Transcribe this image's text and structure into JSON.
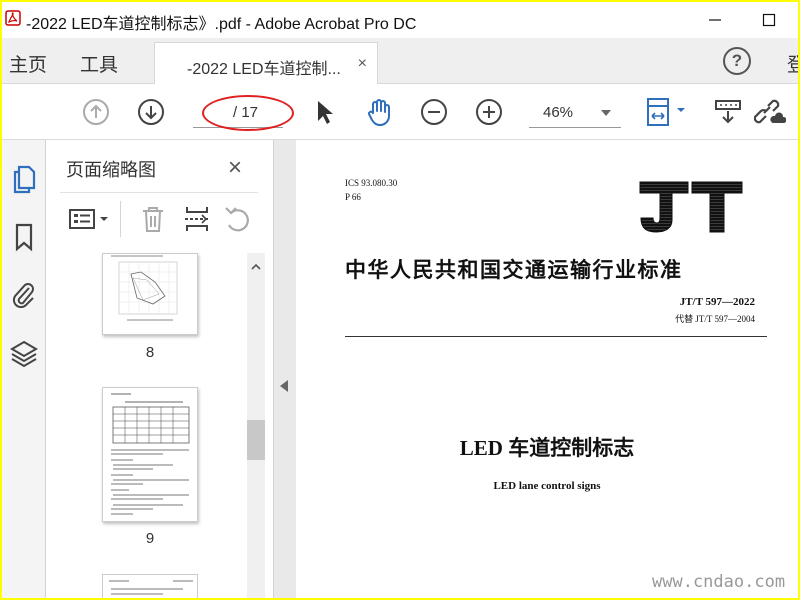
{
  "window": {
    "title": "-2022 LED车道控制标志》.pdf - Adobe Acrobat Pro DC",
    "minimize": "—",
    "maximize": "☐"
  },
  "tabs": {
    "home": "主页",
    "tools": "工具",
    "document": "-2022 LED车道控制...",
    "close": "×",
    "help": "?",
    "cutoff": "登"
  },
  "toolbar": {
    "page_current": "",
    "page_total": "/ 17",
    "zoom": "46%"
  },
  "panel": {
    "title": "页面缩略图",
    "close": "×",
    "thumbnails": [
      {
        "page": "8"
      },
      {
        "page": "9"
      }
    ]
  },
  "document": {
    "ics": "ICS 93.080.30",
    "p_code": "P 66",
    "logo_text": "JT",
    "standard_title": "中华人民共和国交通运输行业标准",
    "standard_no": "JT/T 597—2022",
    "replaces": "代替 JT/T 597—2004",
    "title_cn": "LED 车道控制标志",
    "title_en": "LED lane control signs"
  },
  "watermark": "www.cndao.com",
  "colors": {
    "highlight_frame": "#ffff00",
    "annotation_ellipse": "#e02020",
    "accent_blue": "#2f6fbd"
  },
  "icons": {
    "rail": [
      "page-thumbnails-icon",
      "bookmark-icon",
      "attachment-icon",
      "layers-icon"
    ],
    "toolbar": [
      "prev-page-icon",
      "next-page-icon",
      "select-cursor-icon",
      "hand-tool-icon",
      "zoom-out-icon",
      "zoom-in-icon",
      "fit-page-icon",
      "read-aloud-icon",
      "share-link-icon"
    ]
  }
}
